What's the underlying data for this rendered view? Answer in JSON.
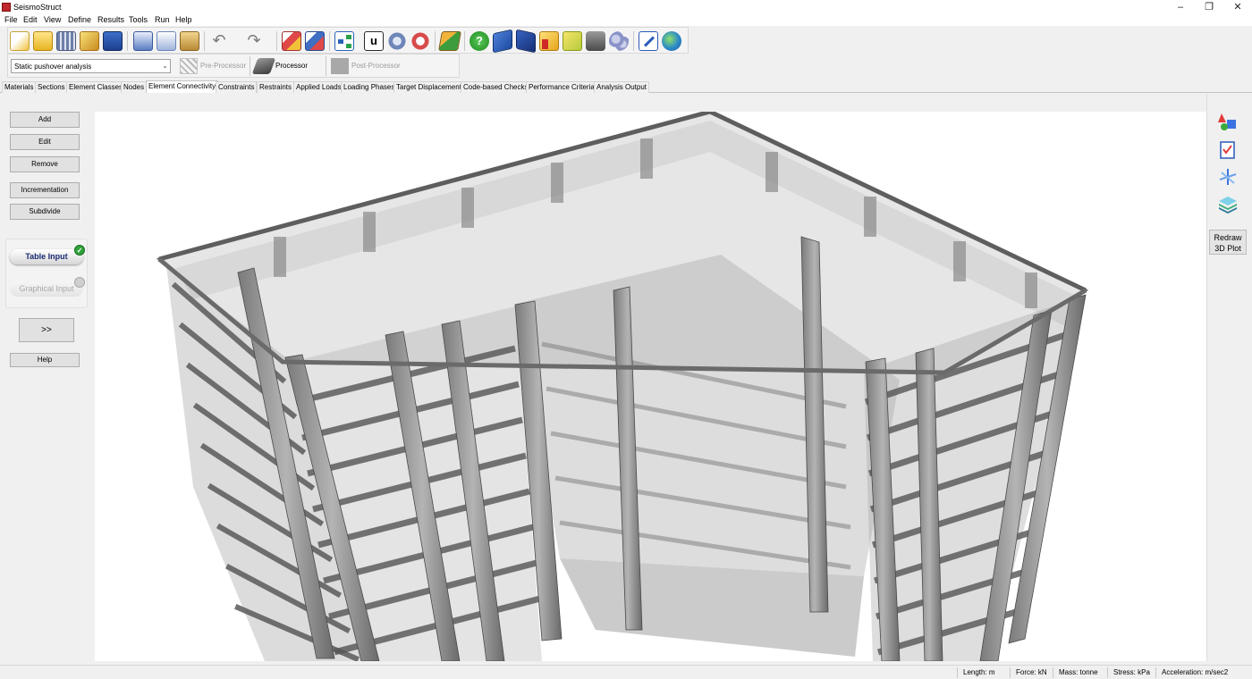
{
  "window": {
    "title": "SeismoStruct"
  },
  "menu": [
    "File",
    "Edit",
    "View",
    "Define",
    "Results",
    "Tools",
    "Run",
    "Help"
  ],
  "analysis": {
    "type": "Static pushover analysis",
    "pre_processor": "Pre-Processor",
    "processor": "Processor",
    "post_processor": "Post-Processor"
  },
  "tabs": [
    "Materials",
    "Sections",
    "Element Classes",
    "Nodes",
    "Element Connectivity",
    "Constraints",
    "Restraints",
    "Applied Loads",
    "Loading Phases",
    "Target Displacement",
    "Code-based Checks",
    "Performance Criteria",
    "Analysis Output"
  ],
  "active_tab": "Element Connectivity",
  "left_panel": {
    "add": "Add",
    "edit": "Edit",
    "remove": "Remove",
    "incrementation": "Incrementation",
    "subdivide": "Subdivide",
    "table_input": "Table Input",
    "graphical_input": "Graphical Input",
    "expand": ">>",
    "help": "Help"
  },
  "right_panel": {
    "redraw_line1": "Redraw",
    "redraw_line2": "3D Plot"
  },
  "status": {
    "length": "Length: m",
    "force": "Force: kN",
    "mass": "Mass: tonne",
    "stress": "Stress: kPa",
    "acceleration": "Acceleration: m/sec2"
  }
}
